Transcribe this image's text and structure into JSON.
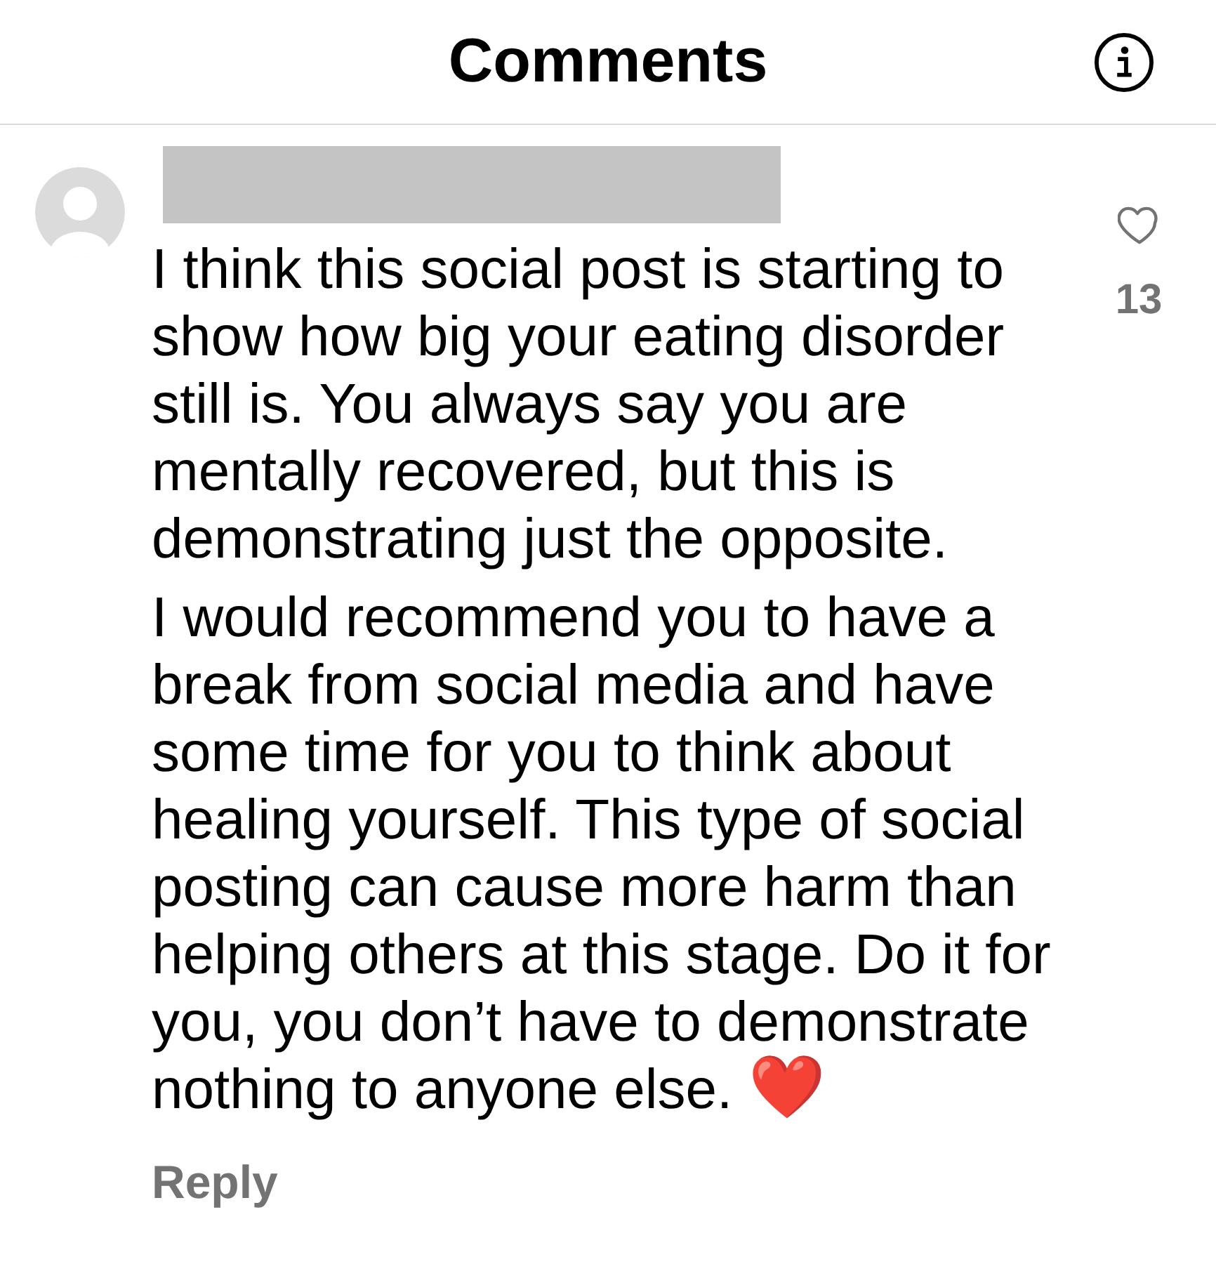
{
  "header": {
    "title": "Comments"
  },
  "comment": {
    "author": {
      "redacted": true
    },
    "paragraphs": [
      {
        "text": "I think this social post is starting to show how big your eating disorder still is. You always say you are mentally recovered, but this is demonstrating just the opposite."
      },
      {
        "text": "I would recommend you to have a break from social media and have some time for you to think about healing yourself. This type of social posting can cause more harm than helping others at this stage. Do it for you, you don’t have to demonstrate nothing to anyone else.",
        "emoji": "❤️"
      }
    ],
    "reply_label": "Reply",
    "like": {
      "liked": false,
      "count": "13"
    }
  }
}
